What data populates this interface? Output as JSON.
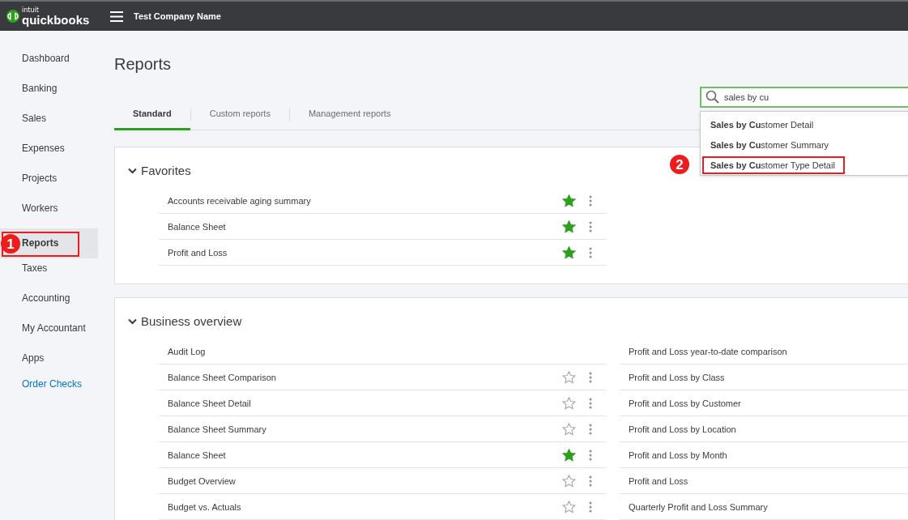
{
  "topbar": {
    "logo_small": "intuit",
    "logo": "quickbooks",
    "company": "Test Company Name"
  },
  "sidebar": {
    "items": [
      {
        "label": "Dashboard",
        "selected": false
      },
      {
        "label": "Banking",
        "selected": false
      },
      {
        "label": "Sales",
        "selected": false
      },
      {
        "label": "Expenses",
        "selected": false
      },
      {
        "label": "Projects",
        "selected": false
      },
      {
        "label": "Workers",
        "selected": false
      },
      {
        "label": "Reports",
        "selected": true,
        "callout": "1"
      },
      {
        "label": "Taxes",
        "selected": false
      },
      {
        "label": "Accounting",
        "selected": false
      },
      {
        "label": "My Accountant",
        "selected": false
      },
      {
        "label": "Apps",
        "selected": false
      }
    ],
    "link": "Order Checks"
  },
  "page_title": "Reports",
  "tabs": [
    {
      "label": "Standard",
      "selected": true
    },
    {
      "label": "Custom reports",
      "selected": false
    },
    {
      "label": "Management reports",
      "selected": false
    }
  ],
  "search": {
    "value": "sales by cu",
    "suggestions": [
      {
        "text": "**Sales by Cu**stomer Detail",
        "highlighted": false
      },
      {
        "text": "**Sales by Cu**stomer Summary",
        "highlighted": false
      },
      {
        "text": "**Sales by Cu**stomer Type Detail",
        "highlighted": true,
        "callout": "2"
      }
    ]
  },
  "sections": [
    {
      "title": "Favorites",
      "columns": [
        [
          {
            "label": "Accounts receivable aging summary",
            "starred": true
          },
          {
            "label": "Balance Sheet",
            "starred": true
          },
          {
            "label": "Profit and Loss",
            "starred": true
          }
        ]
      ]
    },
    {
      "title": "Business overview",
      "columns": [
        [
          {
            "label": "Audit Log"
          },
          {
            "label": "Balance Sheet Comparison",
            "starred": false
          },
          {
            "label": "Balance Sheet Detail",
            "starred": false
          },
          {
            "label": "Balance Sheet Summary",
            "starred": false
          },
          {
            "label": "Balance Sheet",
            "starred": true
          },
          {
            "label": "Budget Overview",
            "starred": false
          },
          {
            "label": "Budget vs. Actuals",
            "starred": false
          }
        ],
        [
          {
            "label": "Profit and Loss year-to-date comparison"
          },
          {
            "label": "Profit and Loss by Class"
          },
          {
            "label": "Profit and Loss by Customer"
          },
          {
            "label": "Profit and Loss by Location"
          },
          {
            "label": "Profit and Loss by Month"
          },
          {
            "label": "Profit and Loss"
          },
          {
            "label": "Quarterly Profit and Loss Summary"
          }
        ]
      ]
    }
  ]
}
